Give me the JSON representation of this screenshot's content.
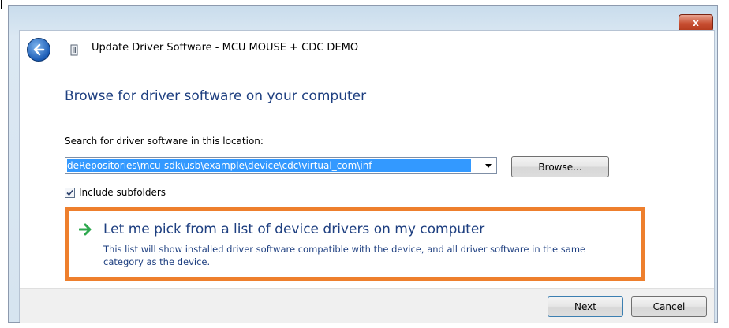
{
  "window": {
    "title": "Update Driver Software - MCU MOUSE + CDC DEMO",
    "close_symbol": "x"
  },
  "page": {
    "heading": "Browse for driver software on your computer",
    "search_label": "Search for driver software in this location:",
    "path_value": "deRepositories\\mcu-sdk\\usb\\example\\device\\cdc\\virtual_com\\inf",
    "browse_label": "Browse...",
    "include_subfolders_label": "Include subfolders",
    "include_subfolders_checked": true
  },
  "pick_option": {
    "title": "Let me pick from a list of device drivers on my computer",
    "description": "This list will show installed driver software compatible with the device, and all driver software in the same category as the device."
  },
  "footer": {
    "next_label": "Next",
    "cancel_label": "Cancel"
  },
  "icons": {
    "back": "back-arrow-icon",
    "device": "usb-device-icon",
    "option_arrow": "green-arrow-icon",
    "dropdown": "chevron-down-icon"
  },
  "colors": {
    "heading": "#1e3f80",
    "highlight_border": "#ee7f2d",
    "selection": "#3399ff",
    "close_button": "#c74e31"
  }
}
